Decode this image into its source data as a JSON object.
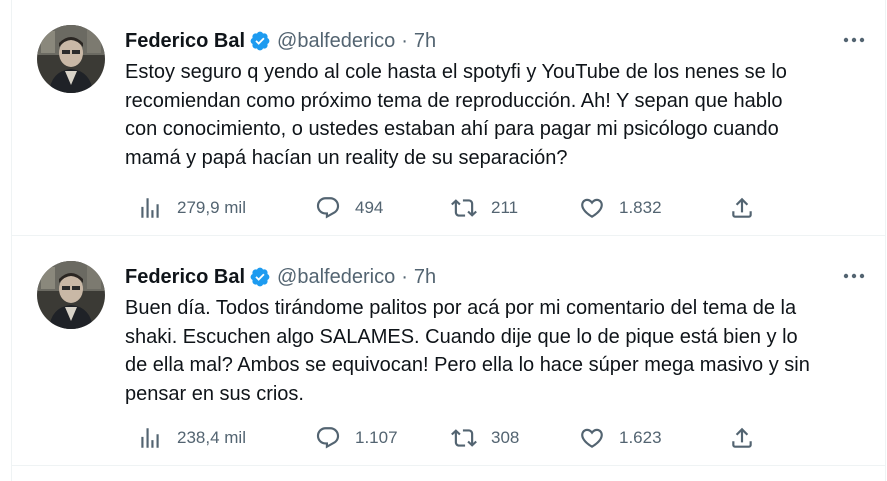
{
  "tweets": [
    {
      "author": {
        "name": "Federico Bal",
        "handle": "@balfederico",
        "separator": "·",
        "time": "7h"
      },
      "text": "Estoy seguro q yendo al cole hasta el spotyfi y YouTube de los nenes se lo\nrecomiendan como próximo tema de reproducción. Ah! Y sepan que hablo\ncon conocimiento, o ustedes estaban ahí para pagar mi psicólogo cuando\nmamá y papá hacían un reality de su separación?",
      "stats": {
        "views": "279,9 mil",
        "replies": "494",
        "retweets": "211",
        "likes": "1.832"
      }
    },
    {
      "author": {
        "name": "Federico Bal",
        "handle": "@balfederico",
        "separator": "·",
        "time": "7h"
      },
      "text": "Buen día. Todos tirándome palitos por acá por mi comentario del tema de la\nshaki. Escuchen algo SALAMES. Cuando dije que lo de pique está bien y lo\nde ella mal? Ambos se equivocan! Pero ella lo hace súper mega masivo y sin\npensar en sus crios.",
      "stats": {
        "views": "238,4 mil",
        "replies": "1.107",
        "retweets": "308",
        "likes": "1.623"
      }
    }
  ],
  "colors": {
    "text": "#0f1419",
    "secondary": "#536471",
    "verified": "#1d9bf0",
    "divider": "#eff3f4"
  }
}
